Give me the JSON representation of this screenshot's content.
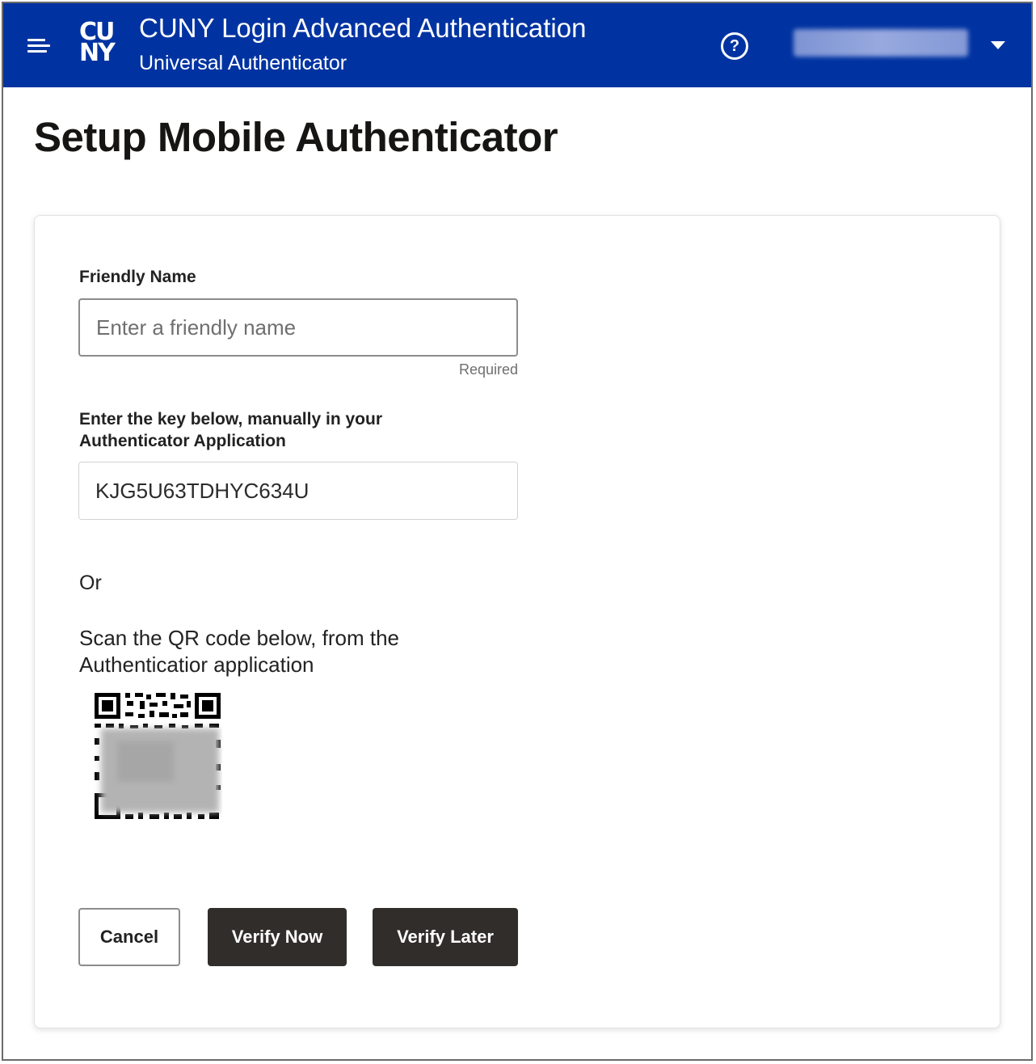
{
  "header": {
    "logo_line1": "CU",
    "logo_line2": "NY",
    "title": "CUNY Login Advanced Authentication",
    "subtitle": "Universal Authenticator",
    "help_glyph": "?",
    "help_icon": "question-circle-icon",
    "menu_icon": "hamburger-menu-icon",
    "user_menu_icon": "caret-down-icon",
    "background_color": "#0033a1"
  },
  "page": {
    "title": "Setup Mobile Authenticator"
  },
  "form": {
    "friendly_name": {
      "label": "Friendly Name",
      "placeholder": "Enter a friendly name",
      "value": "",
      "hint": "Required"
    },
    "key": {
      "label_line1": "Enter the key below, manually in your",
      "label_line2": "Authenticator Application",
      "value": "KJG5U63TDHYC634U"
    },
    "or_text": "Or",
    "scan_line1": "Scan the QR code below, from the",
    "scan_line2": "Authenticatior application",
    "qr_icon": "qr-code-icon"
  },
  "buttons": {
    "cancel": "Cancel",
    "verify_now": "Verify Now",
    "verify_later": "Verify Later",
    "primary_color": "#312d2a"
  }
}
